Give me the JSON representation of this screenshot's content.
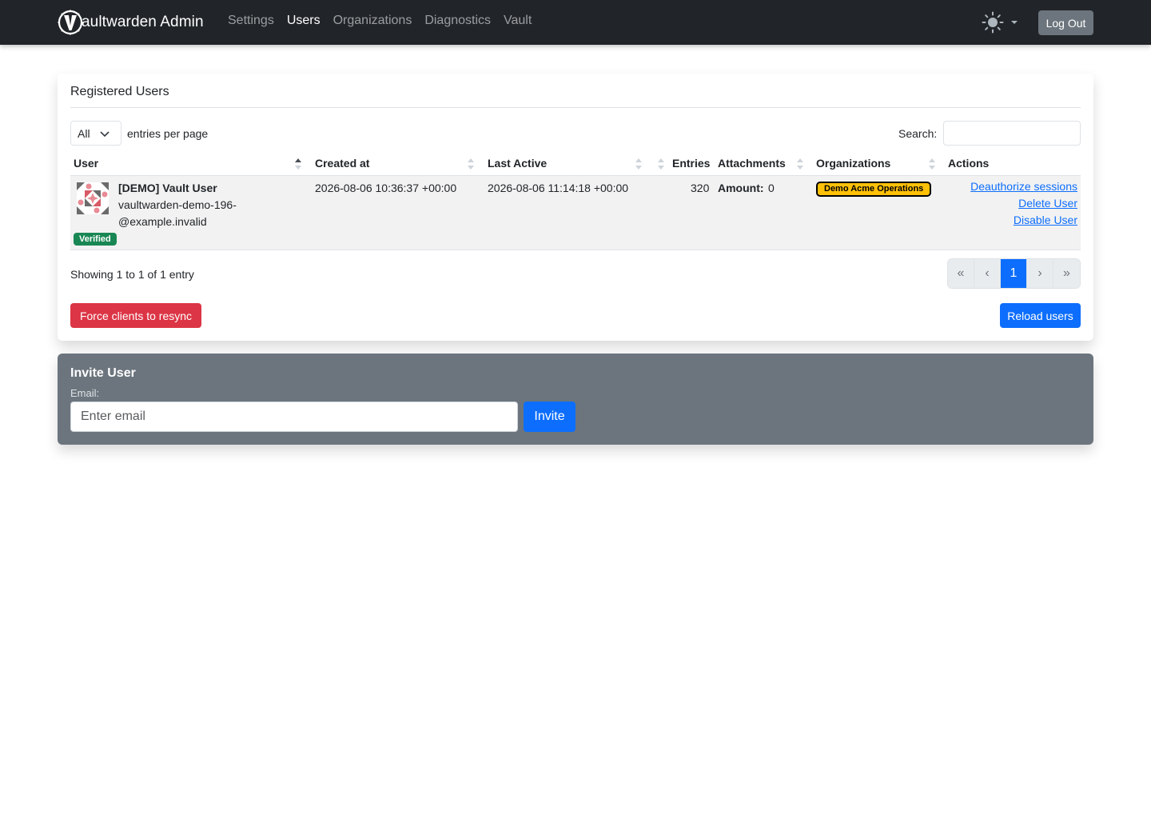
{
  "navbar": {
    "brand_text": "aultwarden Admin",
    "links": [
      {
        "label": "Settings",
        "active": false
      },
      {
        "label": "Users",
        "active": true
      },
      {
        "label": "Organizations",
        "active": false
      },
      {
        "label": "Diagnostics",
        "active": false
      },
      {
        "label": "Vault",
        "active": false
      }
    ],
    "theme_icon": "sun-icon",
    "logout_label": "Log Out"
  },
  "users_card": {
    "title": "Registered Users",
    "per_page_value": "All",
    "per_page_label": "entries per page",
    "search_label": "Search:",
    "search_value": "",
    "columns": [
      "User",
      "Created at",
      "Last Active",
      "Entries",
      "Attachments",
      "Organizations",
      "Actions"
    ],
    "rows": [
      {
        "name": "[DEMO] Vault User",
        "email_line1": "vaultwarden-demo-196-",
        "email_line2": "@example.invalid",
        "badge": "Verified",
        "created_at": "2026-08-06 10:36:37 +00:00",
        "last_active": "2026-08-06 11:14:18 +00:00",
        "entries": "320",
        "attachments_label": "Amount:",
        "attachments_value": "0",
        "organization": "Demo Acme Operations",
        "actions": [
          "Deauthorize sessions",
          "Delete User",
          "Disable User"
        ]
      }
    ],
    "showing_text": "Showing 1 to 1 of 1 entry",
    "pagination": [
      "«",
      "‹",
      "1",
      "›",
      "»"
    ],
    "current_page": "1",
    "force_resync_label": "Force clients to resync",
    "reload_label": "Reload users"
  },
  "invite_card": {
    "title": "Invite User",
    "email_label": "Email:",
    "email_placeholder": "Enter email",
    "invite_label": "Invite"
  },
  "colors": {
    "navbar_bg": "#212529",
    "primary": "#0d6efd",
    "danger": "#dc3545",
    "success": "#198754",
    "warning": "#ffc107",
    "secondary": "#6c757d"
  }
}
